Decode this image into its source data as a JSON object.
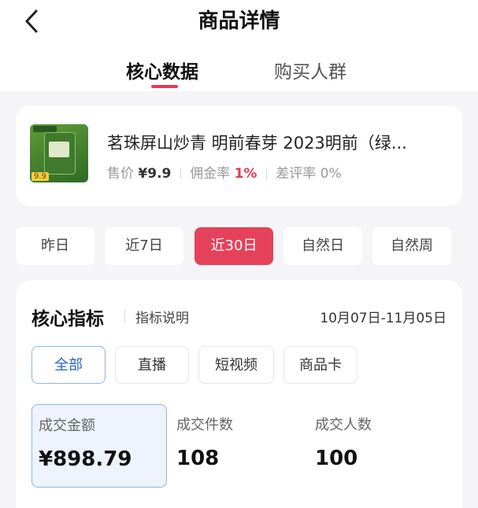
{
  "header": {
    "title": "商品详情"
  },
  "tabs": [
    {
      "label": "核心数据"
    },
    {
      "label": "购买人群"
    }
  ],
  "product": {
    "name": "茗珠屏山炒青 明前春芽 2023明前（绿...",
    "price_label": "售价",
    "price": "¥9.9",
    "commission_label": "佣金率",
    "commission": "1%",
    "bad_review_label": "差评率",
    "bad_review": "0%"
  },
  "periods": [
    {
      "label": "昨日"
    },
    {
      "label": "近7日"
    },
    {
      "label": "近30日",
      "active": true
    },
    {
      "label": "自然日"
    },
    {
      "label": "自然周"
    }
  ],
  "metrics_section": {
    "title": "核心指标",
    "help": "指标说明",
    "date_range": "10月07日-11月05日",
    "channels": [
      {
        "label": "全部",
        "active": true
      },
      {
        "label": "直播"
      },
      {
        "label": "短视频"
      },
      {
        "label": "商品卡"
      }
    ],
    "metrics": [
      {
        "label": "成交金额",
        "value": "¥898.79",
        "active": true
      },
      {
        "label": "成交件数",
        "value": "108"
      },
      {
        "label": "成交人数",
        "value": "100"
      }
    ]
  },
  "colors": {
    "accent": "#e6415a",
    "selected_blue": "#2a62c9"
  }
}
